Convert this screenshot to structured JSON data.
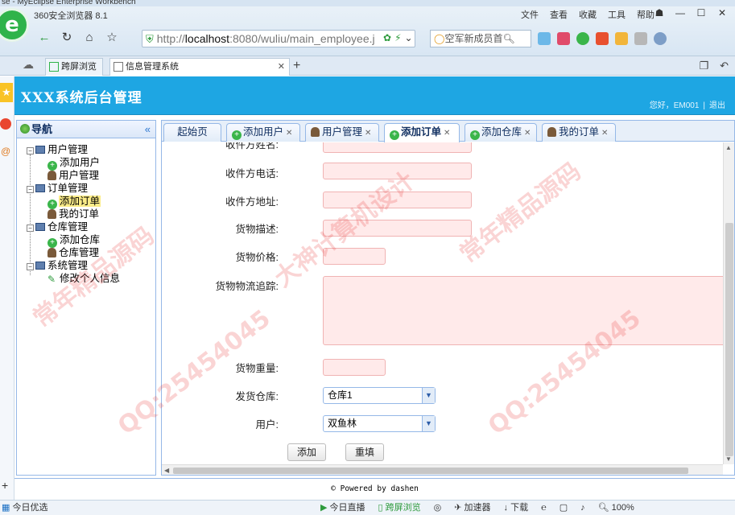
{
  "os": {
    "window_title": "se - MyEclipse Enterprise Workbench"
  },
  "browser": {
    "name": "360安全浏览器 8.1",
    "menu": [
      "文件",
      "查看",
      "收藏",
      "工具",
      "帮助"
    ],
    "url_scheme": "http://",
    "url_host": "localhost",
    "url_rest": ":8080/wuliu/main_employee.j",
    "search_text": "空军新成员首",
    "tabs": [
      {
        "label": "跨屏浏览"
      },
      {
        "label": "信息管理系统"
      }
    ]
  },
  "app": {
    "title": "XXX系统后台管理",
    "welcome": "您好，EM001",
    "logout": "退出",
    "footer": "© Powered by dashen"
  },
  "nav": {
    "title": "导航",
    "groups": [
      {
        "label": "用户管理",
        "children": [
          "添加用户",
          "用户管理"
        ]
      },
      {
        "label": "订单管理",
        "children": [
          "添加订单",
          "我的订单"
        ]
      },
      {
        "label": "仓库管理",
        "children": [
          "添加仓库",
          "仓库管理"
        ]
      },
      {
        "label": "系统管理",
        "children": [
          "修改个人信息"
        ]
      }
    ]
  },
  "content_tabs": [
    "起始页",
    "添加用户",
    "用户管理",
    "添加订单",
    "添加仓库",
    "我的订单"
  ],
  "form": {
    "partial_label": "收件方姓名:",
    "phone_label": "收件方电话:",
    "address_label": "收件方地址:",
    "desc_label": "货物描述:",
    "price_label": "货物价格:",
    "tracking_label": "货物物流追踪:",
    "weight_label": "货物重量:",
    "warehouse_label": "发货仓库:",
    "warehouse_value": "仓库1",
    "user_label": "用户:",
    "user_value": "双鱼林",
    "add_button": "添加",
    "reset_button": "重填"
  },
  "status": {
    "left": "今日优选",
    "right_items": [
      "今日直播",
      "跨屏浏览",
      "加速器",
      "下载"
    ],
    "zoom": "100%"
  },
  "watermark": [
    "QQ:25454045",
    "大神计算机设计",
    "常年精品源码"
  ],
  "colors": {
    "header_blue": "#1ea6e3",
    "required_pink": "#ffeaea",
    "selected_yellow": "#fbec88"
  }
}
